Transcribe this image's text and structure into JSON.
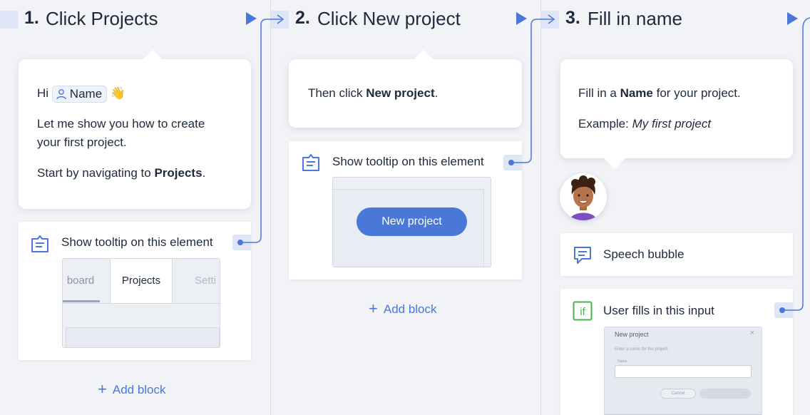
{
  "steps": [
    {
      "number": "1.",
      "title": "Click Projects",
      "message": {
        "greeting": "Hi",
        "name_chip": "Name",
        "emoji": "👋",
        "line1": "Let me show you how to create your first project.",
        "line2_prefix": "Start by navigating to ",
        "line2_bold": "Projects",
        "line2_suffix": "."
      },
      "block": {
        "label": "Show tooltip on this element",
        "preview_tabs": [
          "board",
          "Projects",
          "Setti"
        ]
      },
      "add_block": "Add block"
    },
    {
      "number": "2.",
      "title": "Click New project",
      "message": {
        "prefix": "Then click ",
        "bold": "New project",
        "suffix": "."
      },
      "block": {
        "label": "Show tooltip on this element",
        "preview_button": "New project"
      },
      "add_block": "Add block"
    },
    {
      "number": "3.",
      "title": "Fill in name",
      "message": {
        "line1_prefix": "Fill in a ",
        "line1_bold": "Name",
        "line1_suffix": " for your project.",
        "line2_prefix": "Example: ",
        "line2_italic": "My first project"
      },
      "speech_block": {
        "label": "Speech bubble"
      },
      "input_block": {
        "label": "User fills in this input",
        "preview": {
          "title": "New project",
          "close": "×",
          "hint": "Enter a name for the project.",
          "field_label": "Name",
          "cancel": "Cancel"
        }
      }
    }
  ],
  "colors": {
    "accent": "#4a78d8",
    "background": "#f1f3f7",
    "connector": "#dde5f6",
    "condition": "#4caf50"
  },
  "icons": {
    "play": "play-icon",
    "tooltip": "tooltip-icon",
    "speech": "speech-bubble-icon",
    "condition": "if-condition-icon",
    "user": "user-icon",
    "plus": "plus-icon"
  }
}
